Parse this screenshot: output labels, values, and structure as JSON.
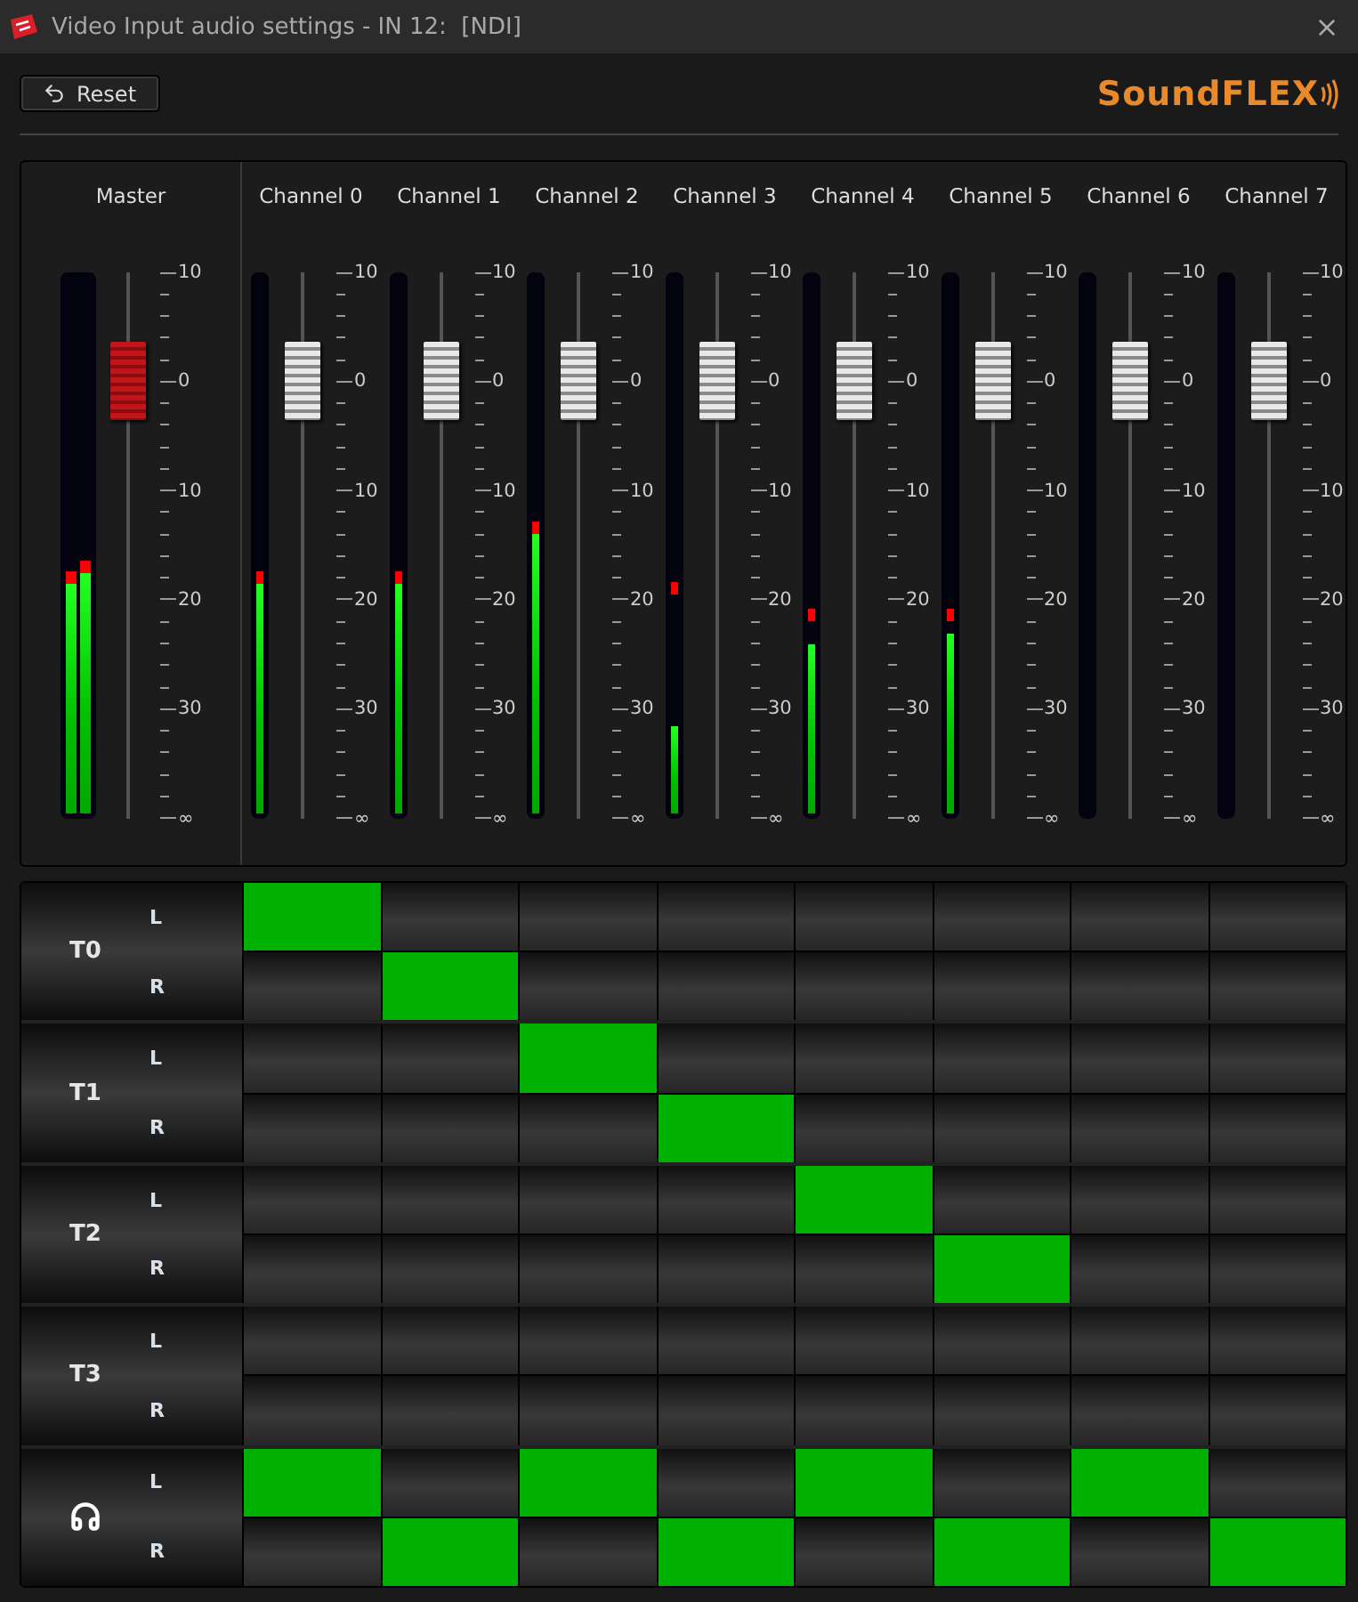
{
  "window": {
    "title": "Video Input audio settings - IN 12:  [NDI]"
  },
  "toolbar": {
    "reset_label": "Reset",
    "logo_text": "SoundFLEX"
  },
  "mixer": {
    "strips": [
      {
        "kind": "master",
        "name": "Master",
        "fader": {
          "level": 0.8
        },
        "scale": [
          "10",
          "0",
          "10",
          "20",
          "30",
          "∞"
        ],
        "meters": [
          {
            "level": 0.43,
            "peak": {
              "level": 0.43
            }
          },
          {
            "level": 0.45,
            "peak": {
              "level": 0.45
            }
          }
        ]
      },
      {
        "kind": "channel",
        "name": "Channel 0",
        "fader": {
          "level": 0.8
        },
        "scale": [
          "10",
          "0",
          "10",
          "20",
          "30",
          "∞"
        ],
        "meters": [
          {
            "level": 0.43,
            "peak": {
              "level": 0.43
            }
          }
        ]
      },
      {
        "kind": "channel",
        "name": "Channel 1",
        "fader": {
          "level": 0.8
        },
        "scale": [
          "10",
          "0",
          "10",
          "20",
          "30",
          "∞"
        ],
        "meters": [
          {
            "level": 0.43,
            "peak": {
              "level": 0.43
            }
          }
        ]
      },
      {
        "kind": "channel",
        "name": "Channel 2",
        "fader": {
          "level": 0.8
        },
        "scale": [
          "10",
          "0",
          "10",
          "20",
          "30",
          "∞"
        ],
        "meters": [
          {
            "level": 0.52,
            "peak": {
              "level": 0.52
            }
          }
        ]
      },
      {
        "kind": "channel",
        "name": "Channel 3",
        "fader": {
          "level": 0.8
        },
        "scale": [
          "10",
          "0",
          "10",
          "20",
          "30",
          "∞"
        ],
        "meters": [
          {
            "level": 0.17,
            "peak": {
              "level": 0.41
            }
          }
        ]
      },
      {
        "kind": "channel",
        "name": "Channel 4",
        "fader": {
          "level": 0.8
        },
        "scale": [
          "10",
          "0",
          "10",
          "20",
          "30",
          "∞"
        ],
        "meters": [
          {
            "level": 0.32,
            "peak": {
              "level": 0.36
            }
          }
        ]
      },
      {
        "kind": "channel",
        "name": "Channel 5",
        "fader": {
          "level": 0.8
        },
        "scale": [
          "10",
          "0",
          "10",
          "20",
          "30",
          "∞"
        ],
        "meters": [
          {
            "level": 0.34,
            "peak": {
              "level": 0.36
            }
          }
        ]
      },
      {
        "kind": "channel",
        "name": "Channel 6",
        "fader": {
          "level": 0.8
        },
        "scale": [
          "10",
          "0",
          "10",
          "20",
          "30",
          "∞"
        ]
      },
      {
        "kind": "channel",
        "name": "Channel 7",
        "fader": {
          "level": 0.8
        },
        "scale": [
          "10",
          "0",
          "10",
          "20",
          "30",
          "∞"
        ]
      }
    ]
  },
  "routing": {
    "groups": [
      {
        "kind": "track",
        "label": "T0",
        "rows": [
          {
            "label": "L",
            "cells": [
              {
                "on": true
              },
              {
                "on": false
              },
              {
                "on": false
              },
              {
                "on": false
              },
              {
                "on": false
              },
              {
                "on": false
              },
              {
                "on": false
              },
              {
                "on": false
              }
            ]
          },
          {
            "label": "R",
            "cells": [
              {
                "on": false
              },
              {
                "on": true
              },
              {
                "on": false
              },
              {
                "on": false
              },
              {
                "on": false
              },
              {
                "on": false
              },
              {
                "on": false
              },
              {
                "on": false
              }
            ]
          }
        ]
      },
      {
        "kind": "track",
        "label": "T1",
        "rows": [
          {
            "label": "L",
            "cells": [
              {
                "on": false
              },
              {
                "on": false
              },
              {
                "on": true
              },
              {
                "on": false
              },
              {
                "on": false
              },
              {
                "on": false
              },
              {
                "on": false
              },
              {
                "on": false
              }
            ]
          },
          {
            "label": "R",
            "cells": [
              {
                "on": false
              },
              {
                "on": false
              },
              {
                "on": false
              },
              {
                "on": true
              },
              {
                "on": false
              },
              {
                "on": false
              },
              {
                "on": false
              },
              {
                "on": false
              }
            ]
          }
        ]
      },
      {
        "kind": "track",
        "label": "T2",
        "rows": [
          {
            "label": "L",
            "cells": [
              {
                "on": false
              },
              {
                "on": false
              },
              {
                "on": false
              },
              {
                "on": false
              },
              {
                "on": true
              },
              {
                "on": false
              },
              {
                "on": false
              },
              {
                "on": false
              }
            ]
          },
          {
            "label": "R",
            "cells": [
              {
                "on": false
              },
              {
                "on": false
              },
              {
                "on": false
              },
              {
                "on": false
              },
              {
                "on": false
              },
              {
                "on": true
              },
              {
                "on": false
              },
              {
                "on": false
              }
            ]
          }
        ]
      },
      {
        "kind": "track",
        "label": "T3",
        "rows": [
          {
            "label": "L",
            "cells": [
              {
                "on": false
              },
              {
                "on": false
              },
              {
                "on": false
              },
              {
                "on": false
              },
              {
                "on": false
              },
              {
                "on": false
              },
              {
                "on": false
              },
              {
                "on": false
              }
            ]
          },
          {
            "label": "R",
            "cells": [
              {
                "on": false
              },
              {
                "on": false
              },
              {
                "on": false
              },
              {
                "on": false
              },
              {
                "on": false
              },
              {
                "on": false
              },
              {
                "on": false
              },
              {
                "on": false
              }
            ]
          }
        ]
      },
      {
        "kind": "headphones",
        "rows": [
          {
            "label": "L",
            "cells": [
              {
                "on": true
              },
              {
                "on": false
              },
              {
                "on": true
              },
              {
                "on": false
              },
              {
                "on": true
              },
              {
                "on": false
              },
              {
                "on": true
              },
              {
                "on": false
              }
            ]
          },
          {
            "label": "R",
            "cells": [
              {
                "on": false
              },
              {
                "on": true
              },
              {
                "on": false
              },
              {
                "on": true
              },
              {
                "on": false
              },
              {
                "on": true
              },
              {
                "on": false
              },
              {
                "on": true
              }
            ]
          }
        ]
      }
    ]
  }
}
